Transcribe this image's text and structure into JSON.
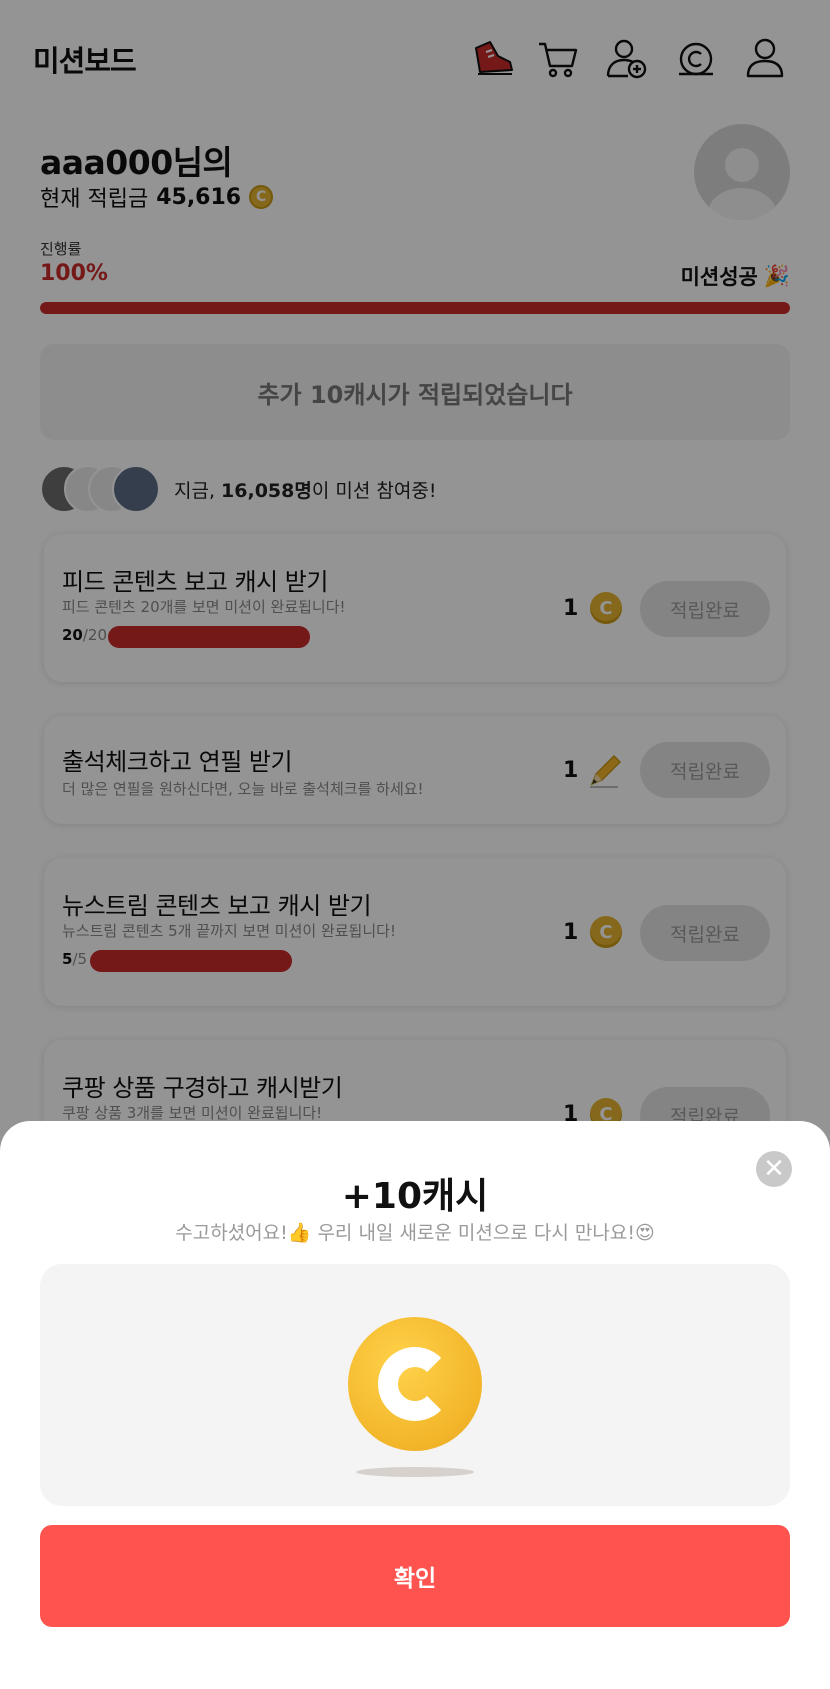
{
  "header": {
    "title": "미션보드",
    "icons": [
      "sneaker-icon",
      "cart-icon",
      "add-user-icon",
      "cash-icon",
      "profile-icon"
    ]
  },
  "user": {
    "greeting": "aaa000님의",
    "balance_label": "현재 적립금",
    "balance_value": "45,616",
    "coin_symbol": "C"
  },
  "progress": {
    "label": "진행률",
    "percent_text": "100%",
    "value": 1.0,
    "status": "미션성공",
    "status_emoji": "🎉"
  },
  "notice": {
    "text": "추가 10캐시가 적립되었습니다"
  },
  "participants": {
    "prefix": "지금, ",
    "count": "16,058명",
    "suffix": "이 미션 참여중!"
  },
  "missions": [
    {
      "title": "피드 콘텐츠 보고 캐시 받기",
      "desc": "피드 콘텐츠 20개를 보면 미션이 완료됩니다!",
      "count_done": "20",
      "count_total": "/20",
      "progress": 1.0,
      "reward": "1",
      "reward_icon": "coin-icon",
      "button": "적립완료"
    },
    {
      "title": "출석체크하고 연필 받기",
      "desc": "더 많은 연필을 원하신다면, 오늘 바로 출석체크를 하세요!",
      "reward": "1",
      "reward_icon": "pencil-icon",
      "button": "적립완료"
    },
    {
      "title": "뉴스트림 콘텐츠 보고 캐시 받기",
      "desc": "뉴스트림 콘텐츠 5개 끝까지 보면 미션이 완료됩니다!",
      "count_done": "5",
      "count_total": "/5",
      "progress": 1.0,
      "reward": "1",
      "reward_icon": "coin-icon",
      "button": "적립완료"
    },
    {
      "title": "쿠팡 상품 구경하고 캐시받기",
      "desc": "쿠팡 상품 3개를 보면 미션이 완료됩니다!",
      "reward": "1",
      "reward_icon": "coin-icon",
      "button": "적립완료"
    }
  ],
  "sheet": {
    "title": "+10캐시",
    "subtitle": "수고하셨어요!👍 우리 내일 새로운 미션으로 다시 만나요!😍",
    "confirm": "확인",
    "close": "✕"
  },
  "colors": {
    "accent_red": "#c92a2a",
    "confirm_red": "#ff5350",
    "coin_gold": "#f2b52a"
  }
}
